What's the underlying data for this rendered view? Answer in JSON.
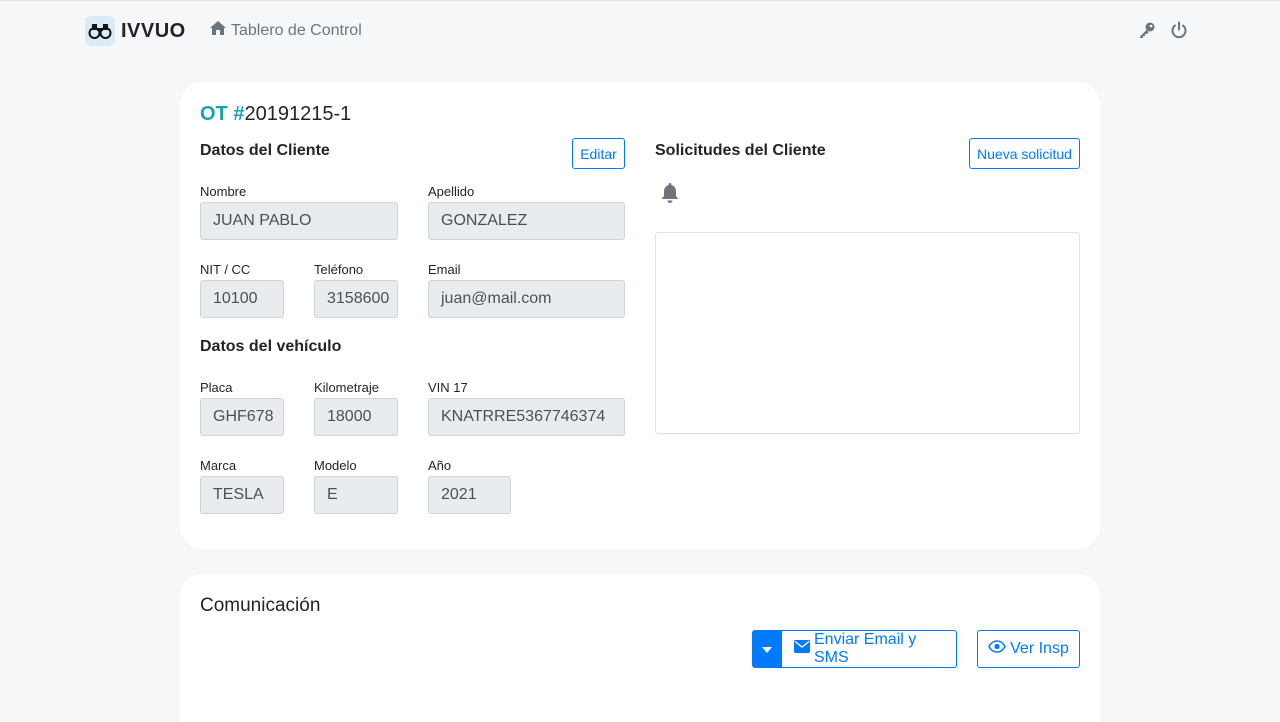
{
  "app": {
    "name": "IVVUO"
  },
  "nav": {
    "dashboard_label": "Tablero de Control"
  },
  "order": {
    "prefix": "OT #",
    "number": "20191215-1"
  },
  "client": {
    "heading": "Datos del Cliente",
    "edit_label": "Editar",
    "fields": {
      "nombre": {
        "label": "Nombre",
        "value": "JUAN PABLO"
      },
      "apellido": {
        "label": "Apellido",
        "value": "GONZALEZ"
      },
      "nit": {
        "label": "NIT / CC",
        "value": "10100"
      },
      "telefono": {
        "label": "Teléfono",
        "value": "3158600"
      },
      "email": {
        "label": "Email",
        "value": "juan@mail.com"
      }
    }
  },
  "vehicle": {
    "heading": "Datos del vehículo",
    "fields": {
      "placa": {
        "label": "Placa",
        "value": "GHF678"
      },
      "km": {
        "label": "Kilometraje",
        "value": "18000"
      },
      "vin": {
        "label": "VIN 17",
        "value": "KNATRRE5367746374"
      },
      "marca": {
        "label": "Marca",
        "value": "TESLA"
      },
      "modelo": {
        "label": "Modelo",
        "value": "E"
      },
      "anio": {
        "label": "Año",
        "value": "2021"
      }
    }
  },
  "requests": {
    "heading": "Solicitudes del Cliente",
    "new_label": "Nueva solicitud"
  },
  "communication": {
    "heading": "Comunicación",
    "send_label": "Enviar Email y SMS",
    "view_label": "Ver Insp"
  },
  "colors": {
    "accent": "#007bff",
    "ot_label": "#17a2b8",
    "background": "#f6f7f9"
  },
  "icons": {
    "logo": "binoculars-icon",
    "dashboard": "home-icon",
    "key": "key-icon",
    "power": "power-icon",
    "bell": "bell-icon",
    "envelope": "envelope-icon",
    "eye": "eye-icon",
    "caret": "caret-down-icon"
  }
}
